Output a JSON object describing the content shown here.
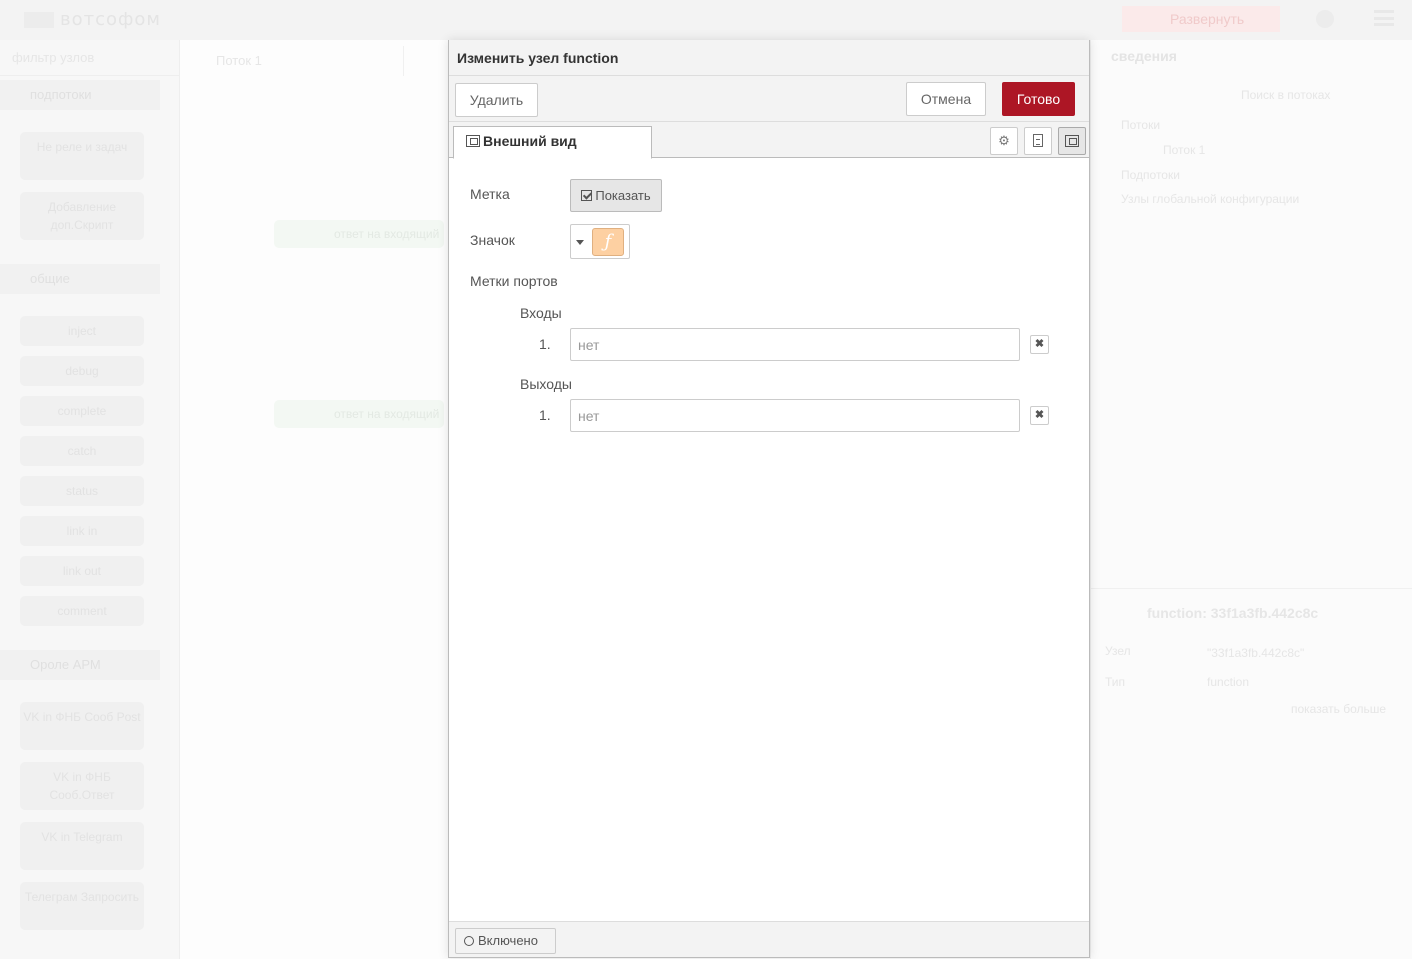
{
  "background": {
    "logo_text": "вотсофом",
    "deploy_label": "Развернуть",
    "palette_search": "фильтр узлов",
    "palette_categories": [
      "подпотоки",
      "общие",
      "Ороле АРМ"
    ],
    "palette_nodes": [
      "Не реле и задач",
      "Добавление доп.Скрипт",
      "inject",
      "debug",
      "complete",
      "catch",
      "status",
      "link in",
      "link out",
      "comment",
      "VK in ФНБ Сооб Post",
      "VK in ФНБ Сооб.Ответ",
      "VK in Telegram",
      "Телеграм Запросить"
    ],
    "workspace_tab": "Поток 1",
    "canvas_nodes": [
      "ответ на входящий",
      "ответ на входящий"
    ],
    "sidebar_title": "сведения",
    "sidebar_search": "Поиск в потоках",
    "sidebar_tree": [
      "Потоки",
      "Поток 1",
      "Подпотоки",
      "Узлы глобальной конфигурации"
    ],
    "sidebar_node_title": "function: 33f1a3fb.442c8c",
    "sidebar_props": [
      "Узел",
      "\"33f1a3fb.442c8c\"",
      "Тип",
      "function",
      "показать больше"
    ]
  },
  "tray": {
    "title": "Изменить узел function",
    "delete_label": "Удалить",
    "cancel_label": "Отмена",
    "done_label": "Готово",
    "tab_label": "Внешний вид",
    "label_field": "Метка",
    "show_label": "Показать",
    "icon_field": "Значок",
    "icon_glyph": "ƒ",
    "port_labels": "Метки портов",
    "inputs_heading": "Входы",
    "inputs": [
      {
        "index": "1.",
        "placeholder": "нет"
      }
    ],
    "outputs_heading": "Выходы",
    "outputs": [
      {
        "index": "1.",
        "placeholder": "нет"
      }
    ],
    "enabled_label": "Включено"
  },
  "colors": {
    "done_button": "#ad1625",
    "function_icon": "#fdd0a2"
  }
}
